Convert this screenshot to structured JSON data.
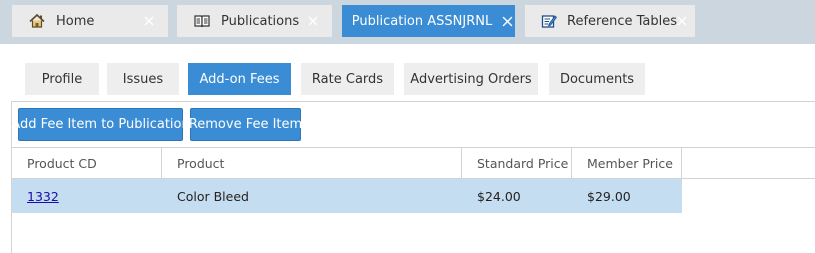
{
  "window_tabs": [
    {
      "label": "Home",
      "icon": "home-icon"
    },
    {
      "label": "Publications",
      "icon": "book-icon"
    },
    {
      "label": "Publication ASSNJRNL",
      "icon": null
    },
    {
      "label": "Reference Tables",
      "icon": "edit-document-icon"
    }
  ],
  "sub_tabs": [
    "Profile",
    "Issues",
    "Add-on Fees",
    "Rate Cards",
    "Advertising Orders",
    "Documents"
  ],
  "active_sub_tab": "Add-on Fees",
  "toolbar": {
    "add_label": "Add Fee Item to Publication",
    "remove_label": "Remove Fee Item"
  },
  "grid": {
    "columns": [
      "Product CD",
      "Product",
      "Standard Price",
      "Member Price"
    ],
    "rows": [
      {
        "product_cd": "1332",
        "product": "Color Bleed",
        "standard_price": "$24.00",
        "member_price": "$29.00"
      }
    ]
  },
  "colors": {
    "accent": "#3a8dd4",
    "tabstrip_bg": "#ccd6df",
    "selected_row": "#c5ddf0"
  }
}
